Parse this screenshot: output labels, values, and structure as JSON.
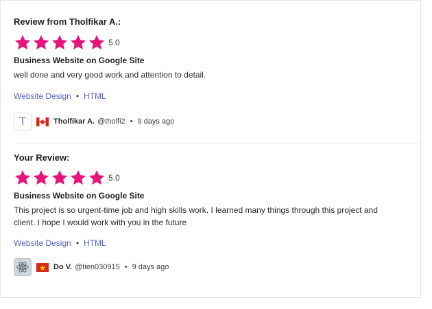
{
  "colors": {
    "star": "#e5157b",
    "link": "#5661c9",
    "flag_red": "#d52b1e",
    "flag_vn_star": "#ffcd00"
  },
  "reviews": [
    {
      "heading": "Review from Tholfikar A.:",
      "rating": "5.0",
      "stars": 5,
      "project_title": "Business Website on Google Site",
      "text": "well done and very good work and attention to detail.",
      "tags": [
        "Website Design",
        "HTML"
      ],
      "author": {
        "avatar_letter": "T",
        "flag": "canada-flag-icon",
        "name": "Tholfikar A.",
        "handle": "@tholfi2",
        "time": "9 days ago"
      }
    },
    {
      "heading": "Your Review:",
      "rating": "5.0",
      "stars": 5,
      "project_title": "Business Website on Google Site",
      "text": "This project is so urgent-time job and high skills work. I learned many things through this project and client. I hope I would work with you in the future",
      "tags": [
        "Website Design",
        "HTML"
      ],
      "author": {
        "avatar_icon": "atom-icon",
        "flag": "vietnam-flag-icon",
        "name": "Do V.",
        "handle": "@tien030915",
        "time": "9 days ago"
      }
    }
  ]
}
